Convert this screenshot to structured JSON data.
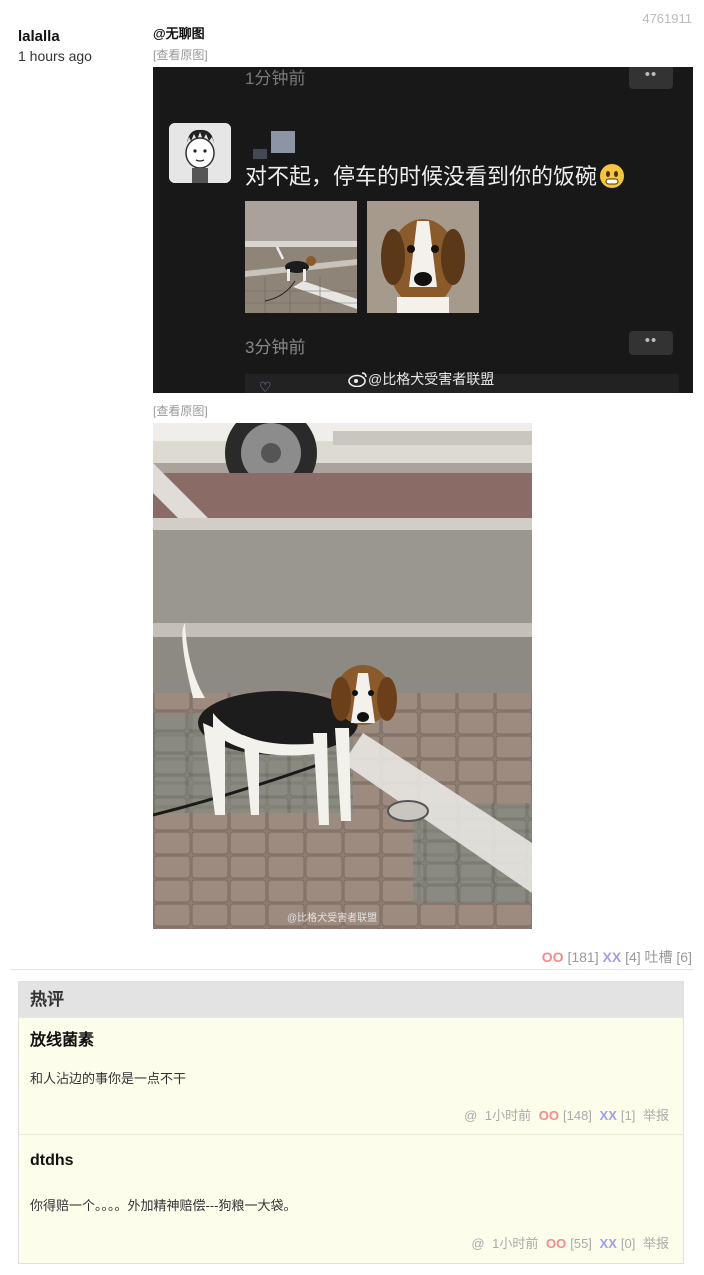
{
  "post": {
    "author": "lalalla",
    "time": "1 hours ago",
    "id": "4761911",
    "tag": "@无聊图",
    "view_original": "[查看原图]"
  },
  "image1": {
    "timestamp_top": "1分钟前",
    "message": "对不起，停车的时候没看到你的饭碗",
    "timestamp_bottom": "3分钟前",
    "more": "••",
    "watermark": "@比格犬受害者联盟"
  },
  "image2": {
    "watermark": "@比格犬受害者联盟"
  },
  "votes": {
    "oo_label": "OO",
    "oo_count": "[181]",
    "xx_label": "XX",
    "xx_count": "[4]",
    "tucao_label": "吐槽",
    "tucao_count": "[6]"
  },
  "hot_comments": {
    "title": "热评",
    "items": [
      {
        "author": "放线菌素",
        "text": "和人沾边的事你是一点不干",
        "at": "@",
        "time": "1小时前",
        "oo_label": "OO",
        "oo_count": "[148]",
        "xx_label": "XX",
        "xx_count": "[1]",
        "report": "举报"
      },
      {
        "author": "dtdhs",
        "text": "你得赔一个。。。。外加精神赔偿---狗粮一大袋。",
        "at": "@",
        "time": "1小时前",
        "oo_label": "OO",
        "oo_count": "[55]",
        "xx_label": "XX",
        "xx_count": "[0]",
        "report": "举报"
      }
    ]
  },
  "colors": {
    "oo": "#f28b8b",
    "xx": "#9f9ff0",
    "hot_bg": "#fdfdec",
    "hot_header_bg": "#e3e3e3"
  }
}
